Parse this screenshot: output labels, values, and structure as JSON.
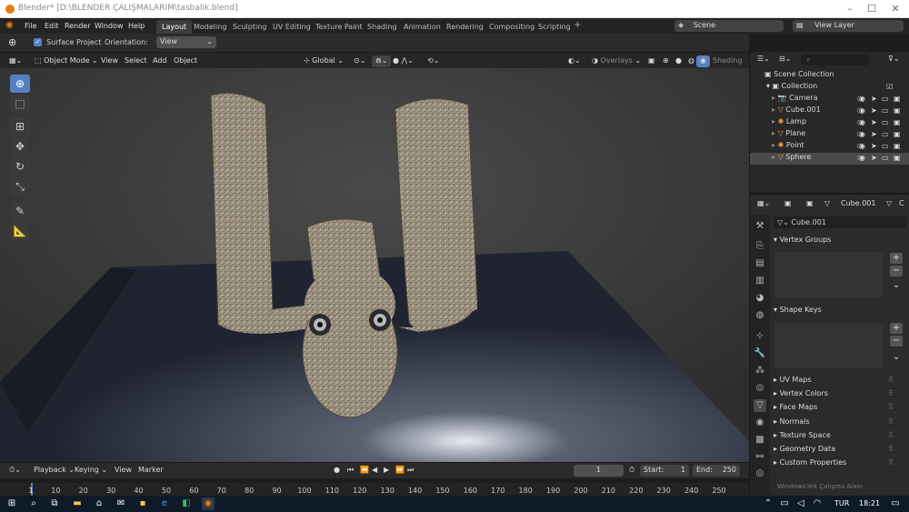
{
  "window": {
    "title": "Blender* [D:\\BLENDER ÇALIŞMALARIM\\tasbalik.blend]"
  },
  "menu": {
    "items": [
      "File",
      "Edit",
      "Render",
      "Window",
      "Help"
    ]
  },
  "workspaces": [
    "Layout",
    "Modeling",
    "Sculpting",
    "UV Editing",
    "Texture Paint",
    "Shading",
    "Animation",
    "Rendering",
    "Compositing",
    "Scripting"
  ],
  "active_workspace": "Layout",
  "scene": {
    "label": "Scene",
    "view_layer": "View Layer"
  },
  "tool_header": {
    "surface_project": "Surface Project",
    "orientation_label": "Orientation:",
    "orientation_value": "View"
  },
  "viewport_header": {
    "mode": "Object Mode",
    "menus": [
      "View",
      "Select",
      "Add",
      "Object"
    ],
    "transform": "Global",
    "overlays": "Overlays",
    "shading": "Shading"
  },
  "outliner": {
    "root": "Scene Collection",
    "collection": "Collection",
    "objects": [
      {
        "name": "Camera",
        "selected": false
      },
      {
        "name": "Cube.001",
        "selected": false
      },
      {
        "name": "Lamp",
        "selected": false
      },
      {
        "name": "Plane",
        "selected": false
      },
      {
        "name": "Point",
        "selected": false
      },
      {
        "name": "Sphere",
        "selected": true
      }
    ]
  },
  "properties": {
    "object_name": "Cube.001",
    "data_name": "Cube.001",
    "header_extra": "C",
    "panels_open": [
      "Vertex Groups",
      "Shape Keys"
    ],
    "panels_closed": [
      "UV Maps",
      "Vertex Colors",
      "Face Maps",
      "Normals",
      "Texture Space",
      "Geometry Data",
      "Custom Properties"
    ]
  },
  "watermark": "Windows'ıIrk Çalışma Alanı",
  "timeline": {
    "menus": [
      "Playback",
      "Keying",
      "View",
      "Marker"
    ],
    "current_frame": "1",
    "start_label": "Start:",
    "start": "1",
    "end_label": "End:",
    "end": "250",
    "ticks": [
      "1",
      "10",
      "20",
      "30",
      "40",
      "50",
      "60",
      "70",
      "80",
      "90",
      "100",
      "110",
      "120",
      "130",
      "140",
      "150",
      "160",
      "170",
      "180",
      "190",
      "200",
      "210",
      "220",
      "230",
      "240",
      "250"
    ]
  },
  "taskbar": {
    "language": "TUR",
    "time": "18:21"
  },
  "colors": {
    "accent": "#5680c2",
    "active_orange": "#e87d0d",
    "selection": "#4a4a4a"
  }
}
